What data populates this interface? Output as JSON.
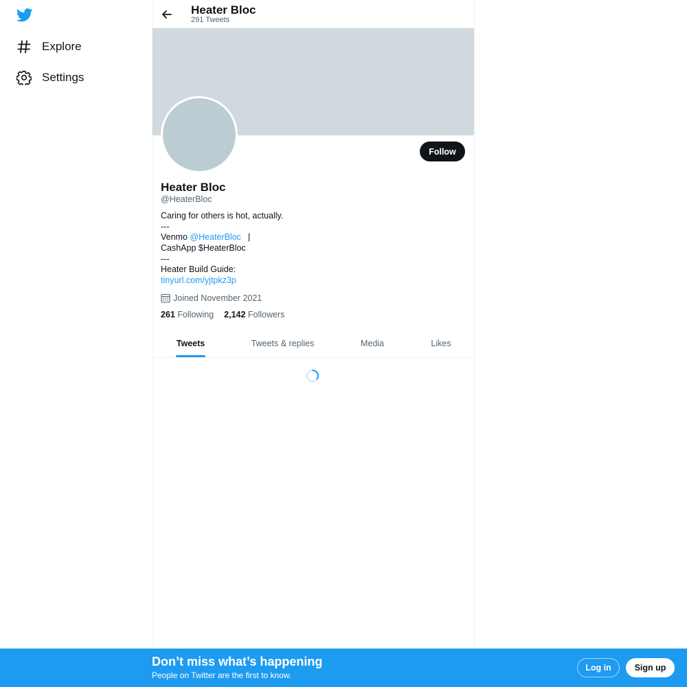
{
  "nav": {
    "logo_icon": "twitter-bird-icon",
    "items": [
      {
        "label": "Explore",
        "icon": "hashtag-icon"
      },
      {
        "label": "Settings",
        "icon": "gear-icon"
      }
    ]
  },
  "header": {
    "name": "Heater Bloc",
    "tweet_count": "291 Tweets",
    "back_icon": "arrow-left-icon"
  },
  "profile": {
    "name": "Heater Bloc",
    "handle": "@HeaterBloc",
    "follow_label": "Follow",
    "bio": {
      "line1": "Caring for others is hot, actually.",
      "line2": "---",
      "venmo_prefix": "Venmo ",
      "venmo_handle": "@HeaterBloc",
      "venmo_sep": "|",
      "line4": "CashApp $HeaterBloc",
      "line5": "---",
      "line6": "Heater Build Guide:",
      "link": "tinyurl.com/yjtpkz3p"
    },
    "joined": "Joined November 2021",
    "joined_icon": "calendar-icon",
    "following_count": "261",
    "following_label": " Following",
    "followers_count": "2,142",
    "followers_label": " Followers"
  },
  "tabs": [
    {
      "label": "Tweets",
      "active": true
    },
    {
      "label": "Tweets & replies",
      "active": false
    },
    {
      "label": "Media",
      "active": false
    },
    {
      "label": "Likes",
      "active": false
    }
  ],
  "bottom_bar": {
    "title": "Don’t miss what’s happening",
    "subtitle": "People on Twitter are the first to know.",
    "login_label": "Log in",
    "signup_label": "Sign up"
  },
  "colors": {
    "accent": "#1d9bf0",
    "banner": "#cfd9de",
    "avatar": "#bcccd3",
    "text": "#0f1419",
    "secondary_text": "#536471"
  }
}
